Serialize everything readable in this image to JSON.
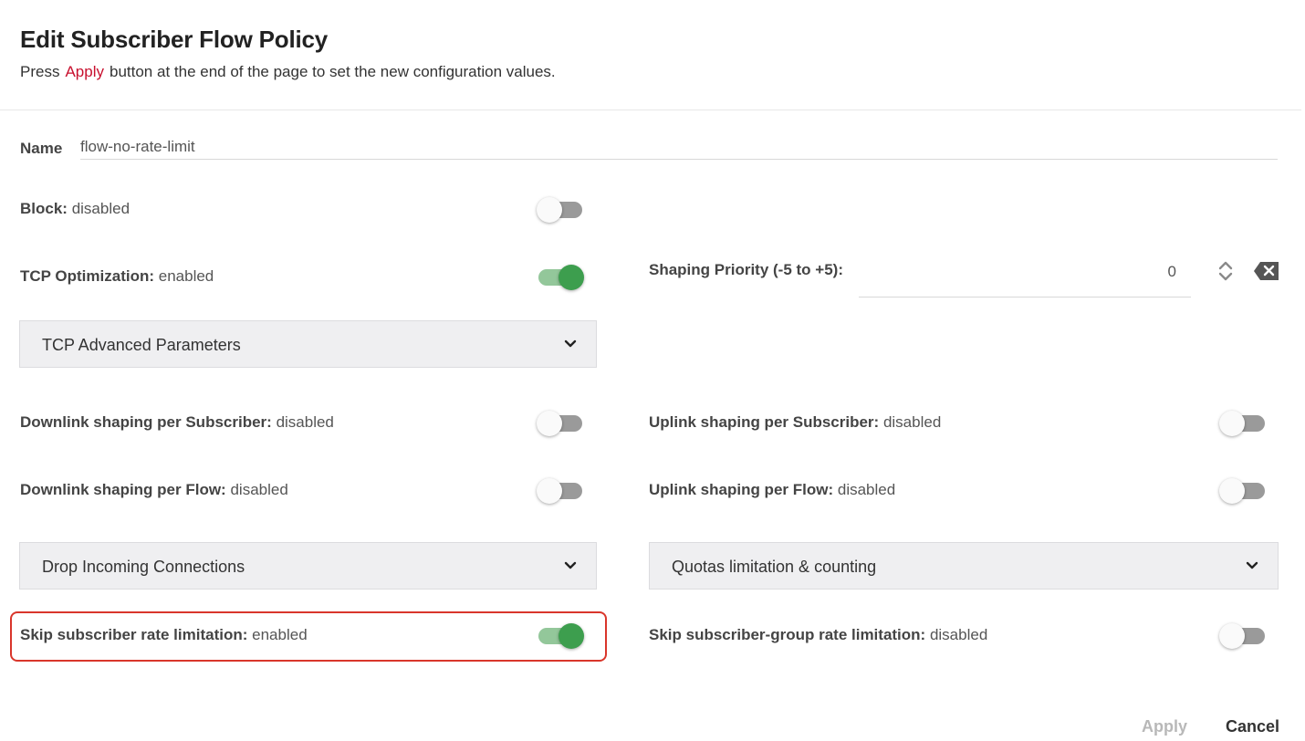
{
  "header": {
    "title": "Edit Subscriber Flow Policy",
    "subtitle_before": "Press",
    "subtitle_accent": "Apply",
    "subtitle_after": "button at the end of the page to set the new configuration values."
  },
  "colors": {
    "accent": "#c8102e",
    "toggle_on": "#3d9e4e",
    "highlight_box": "#d9362b"
  },
  "name_field": {
    "label": "Name",
    "value": "flow-no-rate-limit"
  },
  "block": {
    "label": "Block:",
    "state": "disabled",
    "on": false
  },
  "tcp_optimization": {
    "label": "TCP Optimization:",
    "state": "enabled",
    "on": true
  },
  "shaping_priority": {
    "label": "Shaping Priority (-5 to +5):",
    "value": "0",
    "spinner_icon": "up-down-arrows-icon",
    "clear_icon": "backspace-clear-icon"
  },
  "tcp_advanced": {
    "title": "TCP Advanced Parameters",
    "icon": "chevron-down-icon"
  },
  "downlink_subscriber": {
    "label": "Downlink shaping per Subscriber:",
    "state": "disabled",
    "on": false
  },
  "uplink_subscriber": {
    "label": "Uplink shaping per Subscriber:",
    "state": "disabled",
    "on": false
  },
  "downlink_flow": {
    "label": "Downlink shaping per Flow:",
    "state": "disabled",
    "on": false
  },
  "uplink_flow": {
    "label": "Uplink shaping per Flow:",
    "state": "disabled",
    "on": false
  },
  "drop_incoming": {
    "title": "Drop Incoming Connections",
    "icon": "chevron-down-icon"
  },
  "quotas": {
    "title": "Quotas limitation & counting",
    "icon": "chevron-down-icon"
  },
  "skip_subscriber_rate": {
    "label": "Skip subscriber rate limitation:",
    "state": "enabled",
    "on": true
  },
  "skip_group_rate": {
    "label": "Skip subscriber-group rate limitation:",
    "state": "disabled",
    "on": false
  },
  "footer": {
    "apply_label": "Apply",
    "cancel_label": "Cancel"
  }
}
